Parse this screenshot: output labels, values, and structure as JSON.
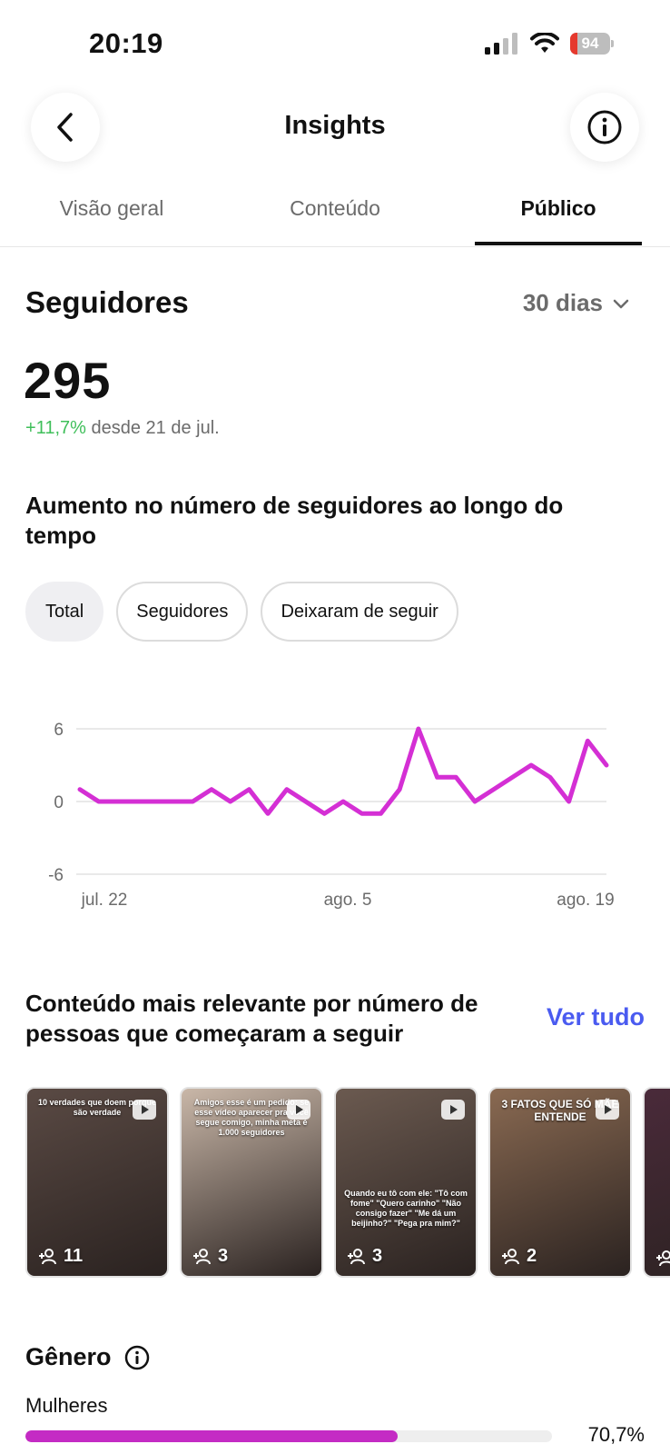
{
  "status": {
    "time": "20:19",
    "battery": "94"
  },
  "nav": {
    "title": "Insights"
  },
  "tabs": [
    {
      "label": "Visão geral",
      "active": false
    },
    {
      "label": "Conteúdo",
      "active": false
    },
    {
      "label": "Público",
      "active": true
    }
  ],
  "followers": {
    "title": "Seguidores",
    "range": "30 dias",
    "count": "295",
    "delta": "+11,7%",
    "since": "desde 21 de jul."
  },
  "growth": {
    "title": "Aumento no número de seguidores ao longo do tempo",
    "filters": [
      "Total",
      "Seguidores",
      "Deixaram de seguir"
    ],
    "active_filter": "Total"
  },
  "chart_data": {
    "type": "line",
    "title": "",
    "xlabel": "",
    "ylabel": "",
    "x_tick_labels": [
      "jul. 22",
      "ago. 5",
      "ago. 19"
    ],
    "y_ticks": [
      6,
      0,
      -6
    ],
    "ylim": [
      -6,
      6
    ],
    "grid": true,
    "color": "#d42fd4",
    "x": [
      "jul. 21",
      "jul. 22",
      "jul. 23",
      "jul. 24",
      "jul. 25",
      "jul. 26",
      "jul. 27",
      "jul. 28",
      "jul. 29",
      "jul. 30",
      "jul. 31",
      "ago. 1",
      "ago. 2",
      "ago. 3",
      "ago. 4",
      "ago. 5",
      "ago. 6",
      "ago. 7",
      "ago. 8",
      "ago. 9",
      "ago. 10",
      "ago. 11",
      "ago. 12",
      "ago. 13",
      "ago. 14",
      "ago. 15",
      "ago. 16",
      "ago. 17",
      "ago. 18",
      "ago. 19",
      "ago. 20"
    ],
    "values": [
      1,
      0,
      0,
      0,
      0,
      0,
      0,
      1,
      0,
      1,
      -1,
      1,
      0,
      -1,
      0,
      -1,
      -1,
      1,
      6,
      2,
      2,
      0,
      1,
      2,
      3,
      2,
      0,
      5,
      3
    ]
  },
  "top_content": {
    "title": "Conteúdo mais relevante por número de pessoas que começaram a seguir",
    "see_all": "Ver tudo",
    "items": [
      {
        "count": "11",
        "caption": "10 verdades que doem porque são verdade",
        "bg": "#5a4a44"
      },
      {
        "count": "3",
        "caption": "Amigos esse é um pedido: se esse vídeo aparecer pra você segue comigo, minha meta é 1.000 seguidores",
        "bg": "#c9b7a8"
      },
      {
        "count": "3",
        "caption": "Quando eu tô com ele: \"Tô com fome\" \"Quero carinho\" \"Não consigo fazer\" \"Me dá um beijinho?\" \"Pega pra mim?\"",
        "bg": "#6b5a50"
      },
      {
        "count": "2",
        "caption": "3 FATOS QUE SÓ MÃE ENTENDE",
        "bg": "#8a6a52"
      },
      {
        "count": "",
        "caption": "",
        "bg": "#4a2a3a"
      }
    ]
  },
  "gender": {
    "title": "Gênero",
    "rows": [
      {
        "label": "Mulheres",
        "pct_text": "70,7%",
        "fraction": 0.707
      }
    ]
  }
}
